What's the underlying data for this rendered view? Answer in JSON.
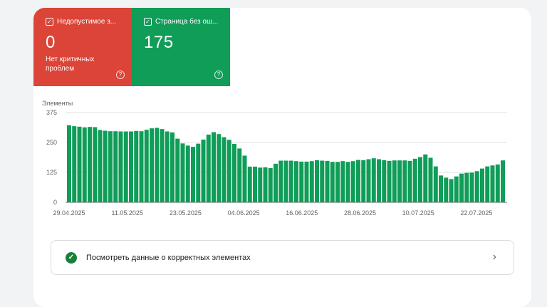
{
  "tiles": {
    "invalid": {
      "label": "Недопустимое з...",
      "value": "0",
      "sub": "Нет критичных проблем",
      "color": "#db4437"
    },
    "valid": {
      "label": "Страница без ош...",
      "value": "175",
      "color": "#0f9d58"
    }
  },
  "chart_data": {
    "type": "bar",
    "ylabel": "Элементы",
    "ylim": [
      0,
      375
    ],
    "yticks": [
      "375",
      "250",
      "125",
      "0"
    ],
    "xticks": [
      "29.04.2025",
      "11.05.2025",
      "23.05.2025",
      "04.06.2025",
      "16.06.2025",
      "28.06.2025",
      "10.07.2025",
      "22.07.2025"
    ],
    "bar_color": "#0f9d58",
    "grid": true,
    "values": [
      322,
      318,
      316,
      313,
      315,
      314,
      302,
      299,
      297,
      297,
      296,
      296,
      296,
      298,
      297,
      303,
      309,
      311,
      306,
      296,
      292,
      266,
      246,
      237,
      232,
      245,
      262,
      283,
      293,
      285,
      272,
      261,
      244,
      225,
      195,
      149,
      149,
      145,
      146,
      143,
      161,
      174,
      174,
      174,
      172,
      170,
      170,
      172,
      176,
      174,
      173,
      169,
      169,
      172,
      169,
      172,
      177,
      176,
      180,
      184,
      180,
      176,
      173,
      175,
      175,
      175,
      173,
      182,
      189,
      200,
      186,
      150,
      112,
      103,
      97,
      108,
      120,
      123,
      124,
      130,
      141,
      150,
      154,
      158,
      175
    ]
  },
  "link": {
    "label": "Посмотреть данные о корректных элементах"
  }
}
